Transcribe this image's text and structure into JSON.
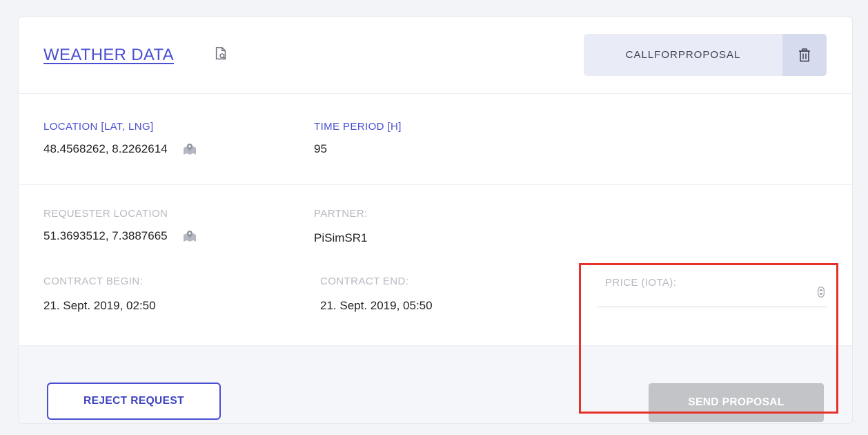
{
  "card": {
    "title": "WEATHER DATA",
    "title_icon": "document-search-icon",
    "status": "CALLFORPROPOSAL",
    "delete_icon": "trash-icon"
  },
  "request": {
    "location_label": "LOCATION [LAT, LNG]",
    "location_value": "48.4568262, 8.2262614",
    "time_period_label": "TIME PERIOD [H]",
    "time_period_value": "95",
    "map_icon": "map-marker-icon"
  },
  "contract": {
    "requester_location_label": "REQUESTER LOCATION",
    "requester_location_value": "51.3693512, 7.3887665",
    "partner_label": "PARTNER:",
    "partner_value": "PiSimSR1",
    "begin_label": "CONTRACT BEGIN:",
    "begin_value": "21. Sept. 2019, 02:50",
    "end_label": "CONTRACT END:",
    "end_value": "21. Sept. 2019, 05:50",
    "price_label": "PRICE (IOTA):",
    "price_value": "",
    "price_placeholder": ""
  },
  "actions": {
    "reject_label": "REJECT REQUEST",
    "send_label": "SEND PROPOSAL"
  },
  "colors": {
    "accent": "#4a4fd1",
    "highlight": "#e8302a",
    "disabled_button": "#c3c4c7"
  }
}
